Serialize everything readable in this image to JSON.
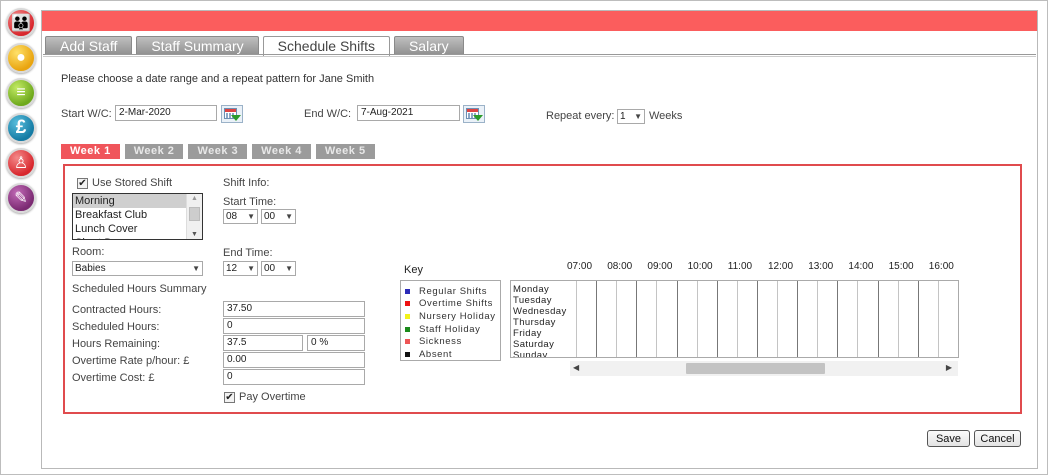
{
  "side_nav": [
    {
      "icon": "family-icon",
      "cls": "ic-family",
      "glyph": "👪"
    },
    {
      "icon": "baby-icon",
      "cls": "ic-baby",
      "glyph": "●"
    },
    {
      "icon": "document-icon",
      "cls": "ic-doc",
      "glyph": "≡"
    },
    {
      "icon": "pound-icon",
      "cls": "ic-pound",
      "glyph": "£"
    },
    {
      "icon": "staff-icon",
      "cls": "ic-person",
      "glyph": "♙"
    },
    {
      "icon": "wrench-icon",
      "cls": "ic-wrench",
      "glyph": "✎"
    }
  ],
  "tabs": [
    "Add Staff",
    "Staff Summary",
    "Schedule Shifts",
    "Salary"
  ],
  "active_tab": 2,
  "intro": "Please choose a date range and a repeat pattern for Jane Smith",
  "date_range": {
    "start_label": "Start W/C:",
    "start_value": "2-Mar-2020",
    "end_label": "End W/C:",
    "end_value": "7-Aug-2021",
    "repeat_label": "Repeat every:",
    "repeat_value": "1",
    "repeat_unit": "Weeks"
  },
  "week_tabs": [
    "Week 1",
    "Week 2",
    "Week 3",
    "Week 4",
    "Week 5"
  ],
  "shift": {
    "use_stored_label": "Use Stored Shift",
    "stored_shifts": [
      "Morning",
      "Breakfast Club",
      "Lunch Cover",
      "Short Day"
    ],
    "selected_shift": "Morning",
    "room_label": "Room:",
    "room_value": "Babies",
    "info_label": "Shift Info:",
    "start_time_label": "Start Time:",
    "start_hour": "08",
    "start_min": "00",
    "end_time_label": "End Time:",
    "end_hour": "12",
    "end_min": "00"
  },
  "hours_summary": {
    "title": "Scheduled Hours Summary",
    "contracted_label": "Contracted Hours:",
    "contracted_value": "37.50",
    "scheduled_label": "Scheduled Hours:",
    "scheduled_value": "0",
    "remaining_label": "Hours Remaining:",
    "remaining_value": "37.5",
    "remaining_pct": "0 %",
    "ot_rate_label": "Overtime Rate p/hour: £",
    "ot_rate_value": "0.00",
    "ot_cost_label": "Overtime Cost: £",
    "ot_cost_value": "0",
    "pay_overtime_label": "Pay Overtime"
  },
  "key": {
    "title": "Key",
    "items": [
      {
        "label": "Regular Shifts",
        "color": "#2b2bb8"
      },
      {
        "label": "Overtime Shifts",
        "color": "#ee1111"
      },
      {
        "label": "Nursery Holiday",
        "color": "#f2f21a"
      },
      {
        "label": "Staff Holiday",
        "color": "#1b8a1b"
      },
      {
        "label": "Sickness",
        "color": "#ee5555"
      },
      {
        "label": "Absent",
        "color": "#111111"
      }
    ]
  },
  "timeline": {
    "hours": [
      "07:00",
      "08:00",
      "09:00",
      "10:00",
      "11:00",
      "12:00",
      "13:00",
      "14:00",
      "15:00",
      "16:00"
    ],
    "days": [
      "Monday",
      "Tuesday",
      "Wednesday",
      "Thursday",
      "Friday",
      "Saturday",
      "Sunday"
    ]
  },
  "buttons": {
    "save": "Save",
    "cancel": "Cancel"
  }
}
